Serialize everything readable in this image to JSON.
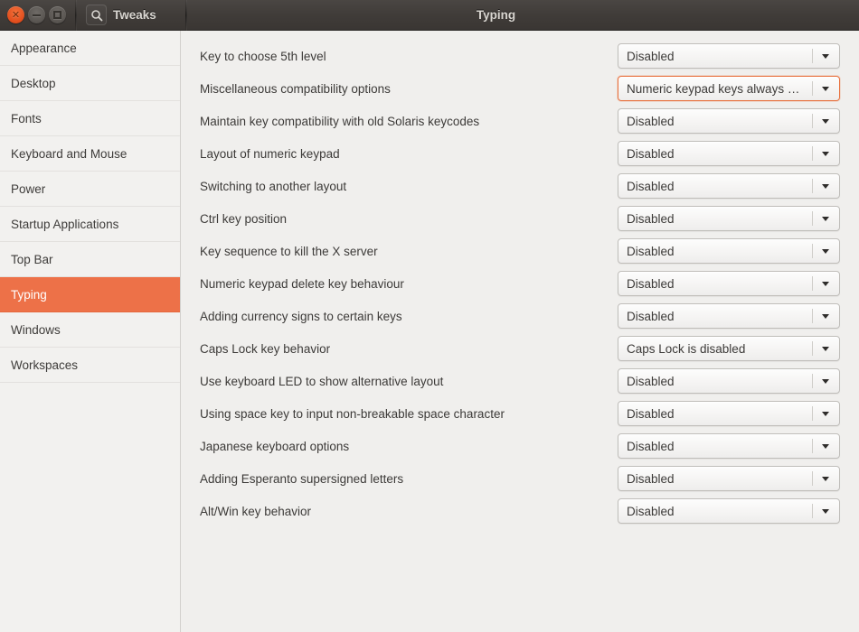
{
  "titlebar": {
    "app_name": "Tweaks",
    "page_title": "Typing",
    "search_icon": "search-icon",
    "controls": [
      {
        "name": "close",
        "glyph": "×"
      },
      {
        "name": "minimize",
        "glyph": ""
      },
      {
        "name": "maximize",
        "glyph": ""
      }
    ]
  },
  "colors": {
    "accent": "#ed7148",
    "focus_border": "#e8713e",
    "content_bg": "#f0efed",
    "sidebar_bg": "#f2f1ef",
    "titlebar_bg": "#403c39",
    "text": "#3c3a38"
  },
  "sidebar": {
    "items": [
      {
        "label": "Appearance",
        "selected": false
      },
      {
        "label": "Desktop",
        "selected": false
      },
      {
        "label": "Fonts",
        "selected": false
      },
      {
        "label": "Keyboard and Mouse",
        "selected": false
      },
      {
        "label": "Power",
        "selected": false
      },
      {
        "label": "Startup Applications",
        "selected": false
      },
      {
        "label": "Top Bar",
        "selected": false
      },
      {
        "label": "Typing",
        "selected": true
      },
      {
        "label": "Windows",
        "selected": false
      },
      {
        "label": "Workspaces",
        "selected": false
      }
    ]
  },
  "main": {
    "rows": [
      {
        "label": "Key to choose 5th level",
        "value": "Disabled",
        "focused": false
      },
      {
        "label": "Miscellaneous compatibility options",
        "value": "Numeric keypad keys always …",
        "focused": true
      },
      {
        "label": "Maintain key compatibility with old Solaris keycodes",
        "value": "Disabled",
        "focused": false
      },
      {
        "label": "Layout of numeric keypad",
        "value": "Disabled",
        "focused": false
      },
      {
        "label": "Switching to another layout",
        "value": "Disabled",
        "focused": false
      },
      {
        "label": "Ctrl key position",
        "value": "Disabled",
        "focused": false
      },
      {
        "label": "Key sequence to kill the X server",
        "value": "Disabled",
        "focused": false
      },
      {
        "label": "Numeric keypad delete key behaviour",
        "value": "Disabled",
        "focused": false
      },
      {
        "label": "Adding currency signs to certain keys",
        "value": "Disabled",
        "focused": false
      },
      {
        "label": "Caps Lock key behavior",
        "value": "Caps Lock is disabled",
        "focused": false
      },
      {
        "label": "Use keyboard LED to show alternative layout",
        "value": "Disabled",
        "focused": false
      },
      {
        "label": "Using space key to input non-breakable space character",
        "value": "Disabled",
        "focused": false
      },
      {
        "label": "Japanese keyboard options",
        "value": "Disabled",
        "focused": false
      },
      {
        "label": "Adding Esperanto supersigned letters",
        "value": "Disabled",
        "focused": false
      },
      {
        "label": "Alt/Win key behavior",
        "value": "Disabled",
        "focused": false
      }
    ]
  }
}
